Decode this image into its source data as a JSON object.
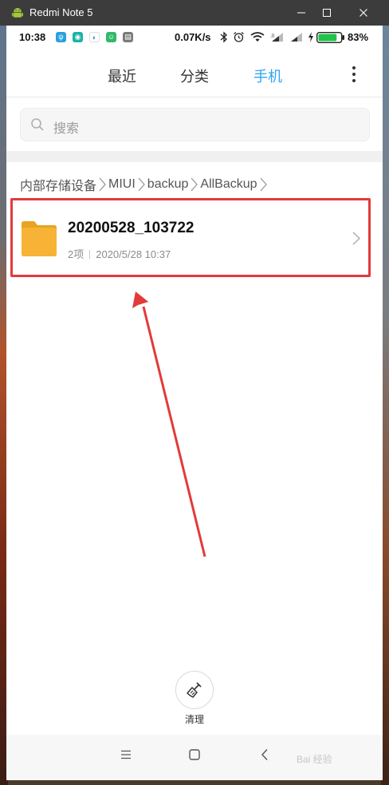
{
  "window": {
    "title": "Redmi Note 5"
  },
  "status_bar": {
    "time": "10:38",
    "net_speed": "0.07K/s",
    "battery_percent": "83%",
    "battery_level": 0.83
  },
  "tabs": [
    {
      "label": "最近",
      "active": false
    },
    {
      "label": "分类",
      "active": false
    },
    {
      "label": "手机",
      "active": true
    }
  ],
  "search": {
    "placeholder": "搜索"
  },
  "breadcrumb": [
    "内部存储设备",
    "MIUI",
    "backup",
    "AllBackup"
  ],
  "files": [
    {
      "name": "20200528_103722",
      "count": "2项",
      "date": "2020/5/28 10:37"
    }
  ],
  "bottom": {
    "clean_label": "清理"
  },
  "watermark": "Bai 经验",
  "colors": {
    "accent": "#2ea3f2",
    "folder": "#f7b336",
    "highlight": "#e23a3a"
  },
  "icons": {
    "search": "search-icon",
    "folder": "folder-icon",
    "chevron": "chevron-right-icon",
    "clean": "broom-icon",
    "menu": "menu-icon",
    "home": "home-icon",
    "back": "back-icon"
  }
}
